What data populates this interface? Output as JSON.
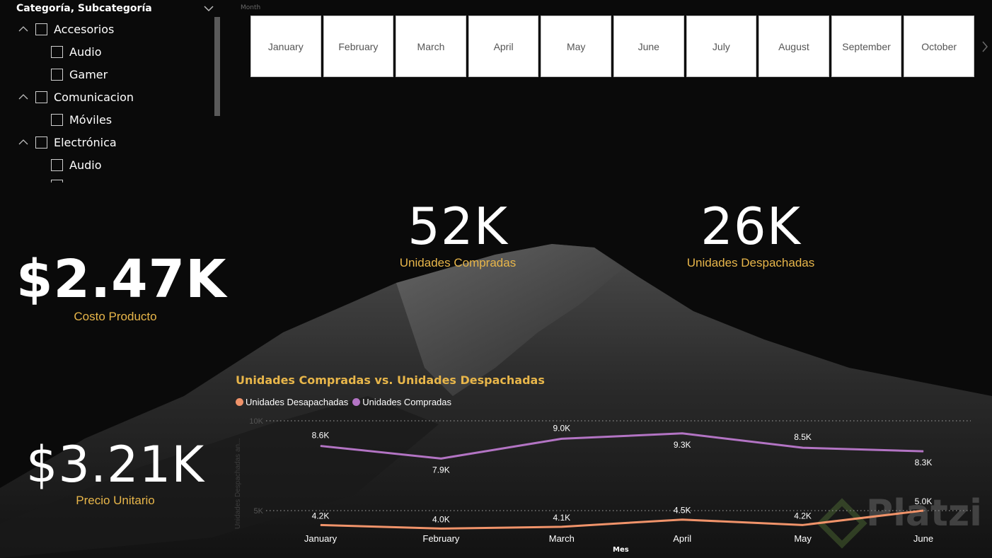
{
  "slicer": {
    "title": "Categoría, Subcategoría",
    "items": [
      {
        "label": "Accesorios",
        "level": 0
      },
      {
        "label": "Audio",
        "level": 1
      },
      {
        "label": "Gamer",
        "level": 1
      },
      {
        "label": "Comunicacion",
        "level": 0
      },
      {
        "label": "Móviles",
        "level": 1
      },
      {
        "label": "Electrónica",
        "level": 0
      },
      {
        "label": "Audio",
        "level": 1
      }
    ]
  },
  "month_slicer": {
    "label": "Month",
    "months": [
      "January",
      "February",
      "March",
      "April",
      "May",
      "June",
      "July",
      "August",
      "September",
      "October"
    ]
  },
  "kpis": {
    "costo": {
      "value": "$2.47K",
      "label": "Costo Producto"
    },
    "precio": {
      "value": "$3.21K",
      "label": "Precio Unitario"
    },
    "compradas": {
      "value": "52K",
      "label": "Unidades Compradas"
    },
    "despachadas": {
      "value": "26K",
      "label": "Unidades Despachadas"
    }
  },
  "colors": {
    "accent": "#e8b64a",
    "compradas": "#b374c4",
    "despachadas": "#f0936a",
    "background": "#0a0a0a"
  },
  "icons": {
    "slicer_chevron": "chevron-down-icon",
    "expander": "chevron-up-icon",
    "month_next": "chevron-right-icon"
  },
  "watermark": "Platzi",
  "chart_data": {
    "type": "line",
    "title": "Unidades Compradas vs. Unidades Despachadas",
    "xlabel": "Mes",
    "ylabel": "Unidades Despachadas an...",
    "categories": [
      "January",
      "February",
      "March",
      "April",
      "May",
      "June"
    ],
    "ylim": [
      0,
      10000
    ],
    "yticks": [
      {
        "value": 10000,
        "label": "10K"
      },
      {
        "value": 5000,
        "label": "5K"
      }
    ],
    "legend_position": "top-left",
    "grid": true,
    "series": [
      {
        "name": "Unidades Desapachadas",
        "values": [
          4200,
          4000,
          4100,
          4500,
          4200,
          5000
        ],
        "labels": [
          "4.2K",
          "4.0K",
          "4.1K",
          "4.5K",
          "4.2K",
          "5.0K"
        ],
        "color": "#f0936a"
      },
      {
        "name": "Unidades Compradas",
        "values": [
          8600,
          7900,
          9000,
          9300,
          8500,
          8300
        ],
        "labels": [
          "8.6K",
          "7.9K",
          "9.0K",
          "9.3K",
          "8.5K",
          "8.3K"
        ],
        "color": "#b374c4"
      }
    ]
  }
}
